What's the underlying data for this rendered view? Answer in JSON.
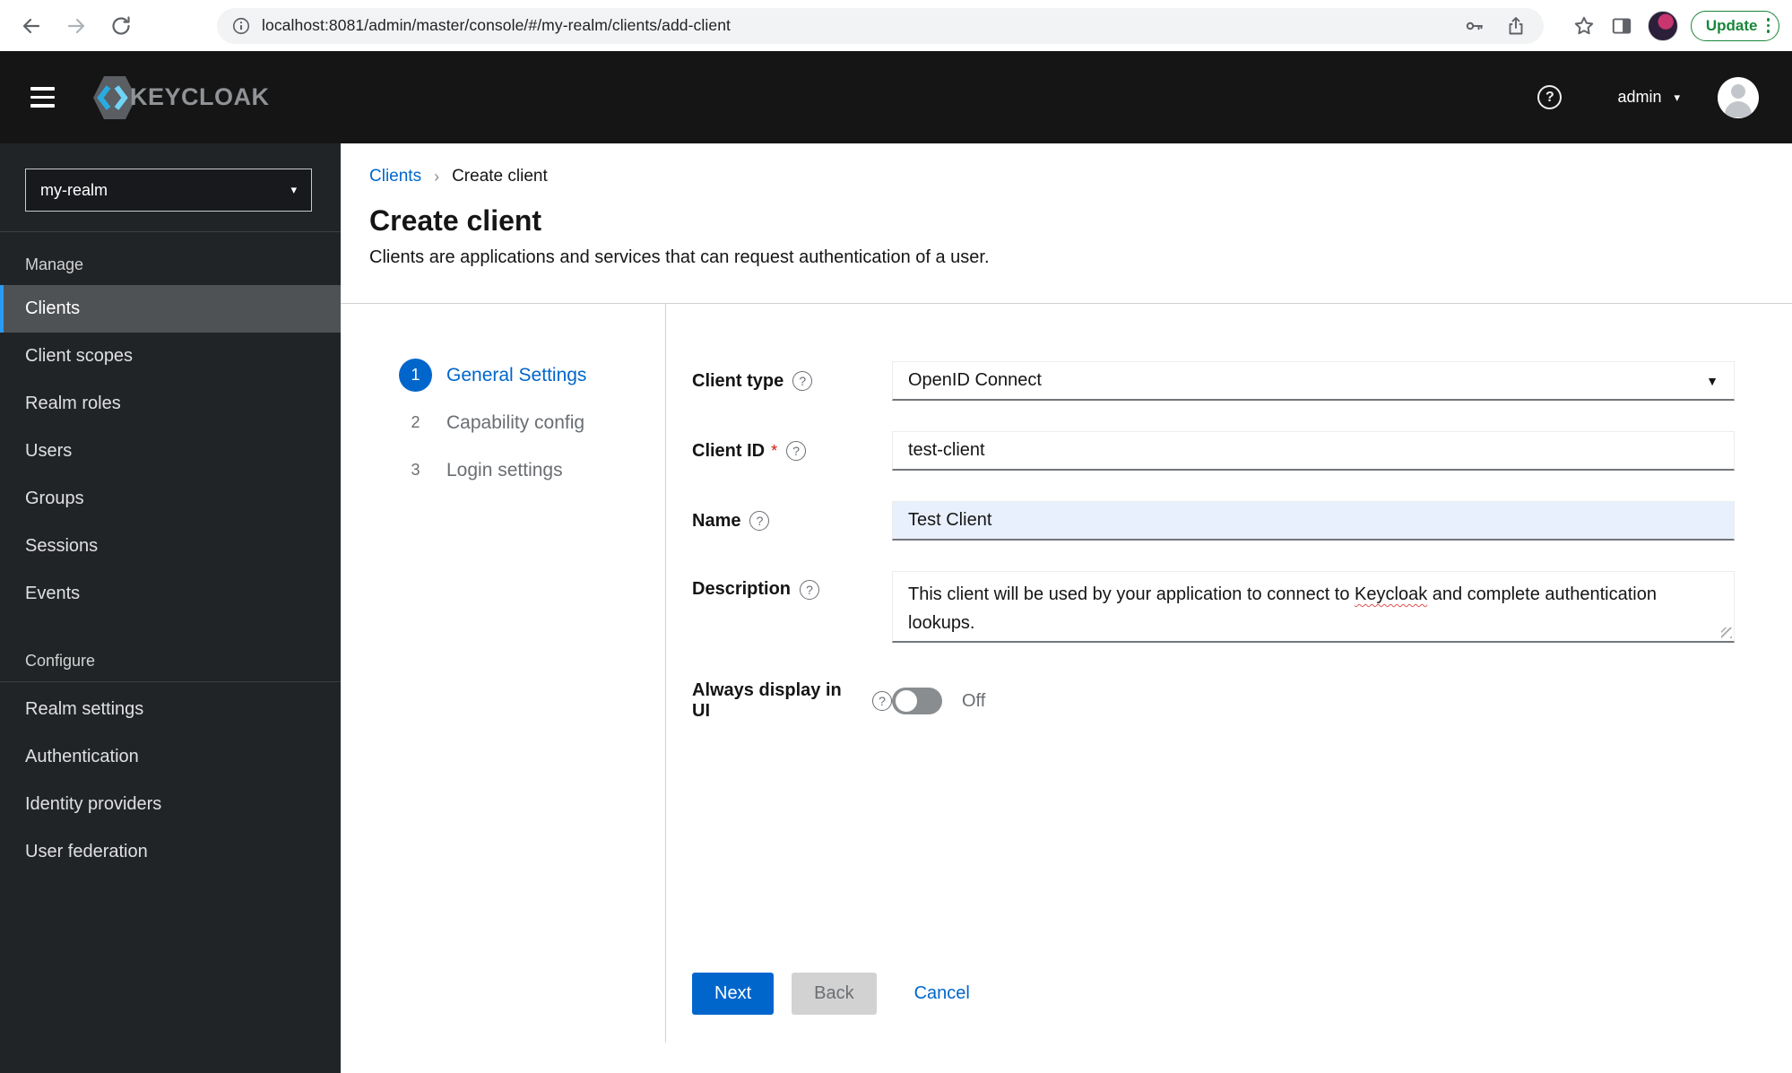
{
  "browser": {
    "url": "localhost:8081/admin/master/console/#/my-realm/clients/add-client",
    "update_label": "Update"
  },
  "header": {
    "brand": "KEYCLOAK",
    "username": "admin"
  },
  "sidebar": {
    "realm": "my-realm",
    "manage": {
      "title": "Manage",
      "items": [
        "Clients",
        "Client scopes",
        "Realm roles",
        "Users",
        "Groups",
        "Sessions",
        "Events"
      ]
    },
    "configure": {
      "title": "Configure",
      "items": [
        "Realm settings",
        "Authentication",
        "Identity providers",
        "User federation"
      ]
    }
  },
  "breadcrumb": {
    "parent": "Clients",
    "current": "Create client"
  },
  "page": {
    "title": "Create client",
    "subtitle": "Clients are applications and services that can request authentication of a user."
  },
  "wizard": {
    "steps": [
      {
        "num": "1",
        "label": "General Settings"
      },
      {
        "num": "2",
        "label": "Capability config"
      },
      {
        "num": "3",
        "label": "Login settings"
      }
    ],
    "active_step": "General Settings"
  },
  "form": {
    "client_type": {
      "label": "Client type",
      "value": "OpenID Connect"
    },
    "client_id": {
      "label": "Client ID",
      "required_marker": "*",
      "value": "test-client"
    },
    "name": {
      "label": "Name",
      "value": "Test Client"
    },
    "description": {
      "label": "Description",
      "text_before": "This client will be used by your application to connect to ",
      "text_misspelled": "Keycloak",
      "text_after": " and complete authentication lookups."
    },
    "always_display": {
      "label": "Always display in UI",
      "state": "Off"
    }
  },
  "footer": {
    "next": "Next",
    "back": "Back",
    "cancel": "Cancel"
  },
  "colors": {
    "primary_blue": "#0066cc",
    "masthead_bg": "#151515",
    "sidenav_bg": "#212427",
    "nav_active_bg": "#4f5255",
    "nav_active_accent": "#2b9af3",
    "autofill_bg": "#e8f0fe",
    "update_green": "#198639",
    "required_red": "#c9190b",
    "toggle_off_gray": "#8a8d90"
  }
}
